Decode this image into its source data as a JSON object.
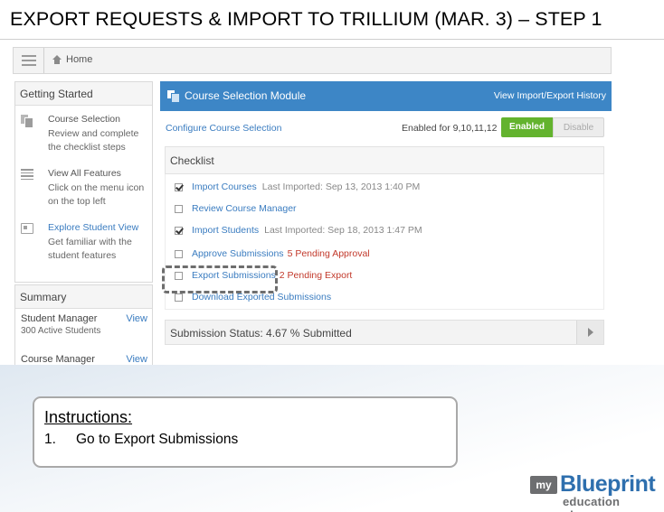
{
  "slide": {
    "title": "EXPORT REQUESTS & IMPORT TO TRILLIUM (MAR. 3) – STEP 1"
  },
  "topbar": {
    "home_label": "Home"
  },
  "getting_started": {
    "title": "Getting Started",
    "items": [
      {
        "icon": "pages-icon",
        "link": "Course Selection",
        "desc": "Review and complete the checklist steps"
      },
      {
        "icon": "menu-list-icon",
        "link": "View All Features",
        "desc": "Click on the menu icon on the top left"
      },
      {
        "icon": "student-card-icon",
        "link": "Explore Student View",
        "desc": "Get familiar with the student features"
      }
    ]
  },
  "summary": {
    "title": "Summary",
    "rows": [
      {
        "label": "Student Manager",
        "view": "View",
        "sub": "300 Active Students"
      },
      {
        "label": "Course Manager",
        "view": "View",
        "sub": ""
      }
    ]
  },
  "module": {
    "title": "Course Selection Module",
    "history_link": "View Import/Export History",
    "configure_link": "Configure Course Selection",
    "enabled_for": "Enabled for 9,10,11,12",
    "enabled_btn": "Enabled",
    "disable_btn": "Disable",
    "checklist_title": "Checklist",
    "checklist": [
      {
        "label": "Import Courses",
        "checked": true,
        "note": "Last Imported: Sep 13, 2013 1:40 PM",
        "note_red": ""
      },
      {
        "label": "Review Course Manager",
        "checked": false,
        "note": "",
        "note_red": ""
      },
      {
        "label": "Import Students",
        "checked": true,
        "note": "Last Imported: Sep 18, 2013 1:47 PM",
        "note_red": ""
      },
      {
        "label": "Approve Submissions",
        "checked": false,
        "note": "",
        "note_red": "5 Pending Approval"
      },
      {
        "label": "Export Submissions",
        "checked": false,
        "note": "",
        "note_red": "2 Pending Export"
      },
      {
        "label": "Download Exported Submissions",
        "checked": false,
        "note": "",
        "note_red": ""
      }
    ],
    "status_text": "Submission Status: 4.67 % Submitted"
  },
  "instructions": {
    "title": "Instructions:",
    "steps": [
      {
        "num": "1.",
        "text": "Go to Export Submissions"
      }
    ]
  },
  "logo": {
    "my": "my",
    "brand": "Blueprint",
    "tagline": "education planner"
  },
  "colors": {
    "accent_blue": "#3d86c6",
    "enabled_green": "#63b32e",
    "link_blue": "#3a7cc0",
    "pending_red": "#c2392b"
  }
}
